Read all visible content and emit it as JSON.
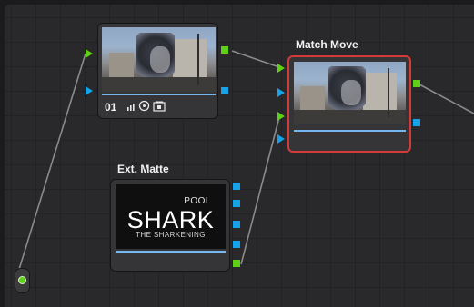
{
  "nodes": {
    "node01": {
      "number": "01",
      "icons": [
        "bars-icon",
        "timer-icon",
        "cache-icon"
      ]
    },
    "match_move": {
      "label": "Match Move"
    },
    "ext_matte": {
      "label": "Ext. Matte",
      "slate": {
        "pool": "POOL",
        "title": "SHARK",
        "subtitle": "THE SHARKENING"
      }
    }
  },
  "colors": {
    "rgb_port": "#5fcf18",
    "alpha_port": "#17a3e8",
    "selection": "#d33a3a",
    "wire": "#8a8a8a"
  }
}
